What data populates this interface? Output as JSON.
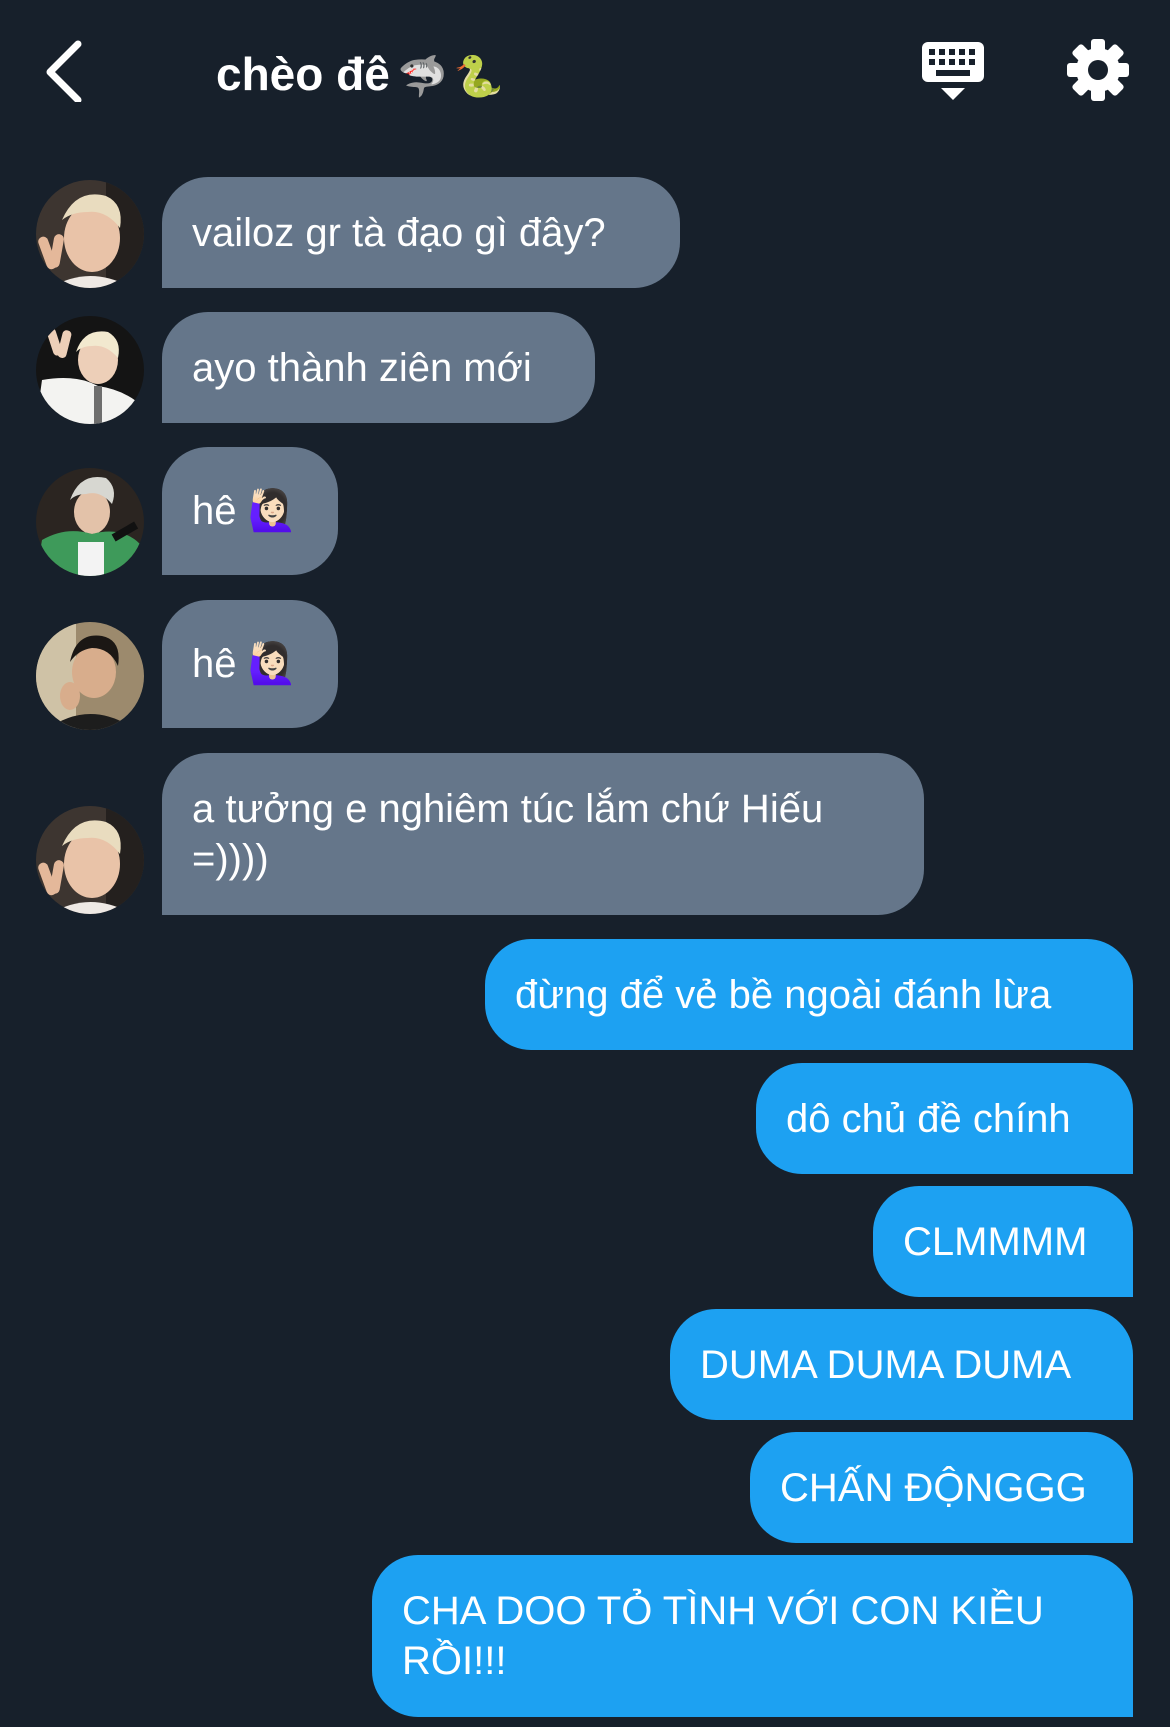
{
  "header": {
    "title": "chèo đê",
    "title_emoji": "🦈🐍",
    "back_icon": "chevron-left-icon",
    "keyboard_icon": "keyboard-icon",
    "settings_icon": "gear-icon"
  },
  "messages": [
    {
      "side": "in",
      "sender_avatar": "avatar-blond-peace-sign",
      "text": "vailoz gr tà đạo gì đây?"
    },
    {
      "side": "in",
      "sender_avatar": "avatar-white-shirt-peace-sign",
      "text": "ayo thành ziên mới"
    },
    {
      "side": "in",
      "sender_avatar": "avatar-green-jacket",
      "text": "hê 🙋🏻‍♀️"
    },
    {
      "side": "in",
      "sender_avatar": "avatar-dark-hair",
      "text": "hê 🙋🏻‍♀️"
    },
    {
      "side": "in",
      "sender_avatar": "avatar-blond-peace-sign",
      "text": "a tưởng e nghiêm túc lắm chứ Hiếu =))))"
    },
    {
      "side": "out",
      "text": "đừng để vẻ bề ngoài đánh lừa"
    },
    {
      "side": "out",
      "text": "dô chủ đề chính"
    },
    {
      "side": "out",
      "text": "CLMMMM"
    },
    {
      "side": "out",
      "text": "DUMA DUMA DUMA"
    },
    {
      "side": "out",
      "text": "CHẤN ĐỘNGGG"
    },
    {
      "side": "out",
      "text": "CHA DOO TỎ TÌNH VỚI CON KIỀU RỒI!!!"
    }
  ],
  "colors": {
    "background": "#17202b",
    "incoming_bubble": "#65768a",
    "outgoing_bubble": "#1da1f2",
    "text": "#ffffff"
  }
}
